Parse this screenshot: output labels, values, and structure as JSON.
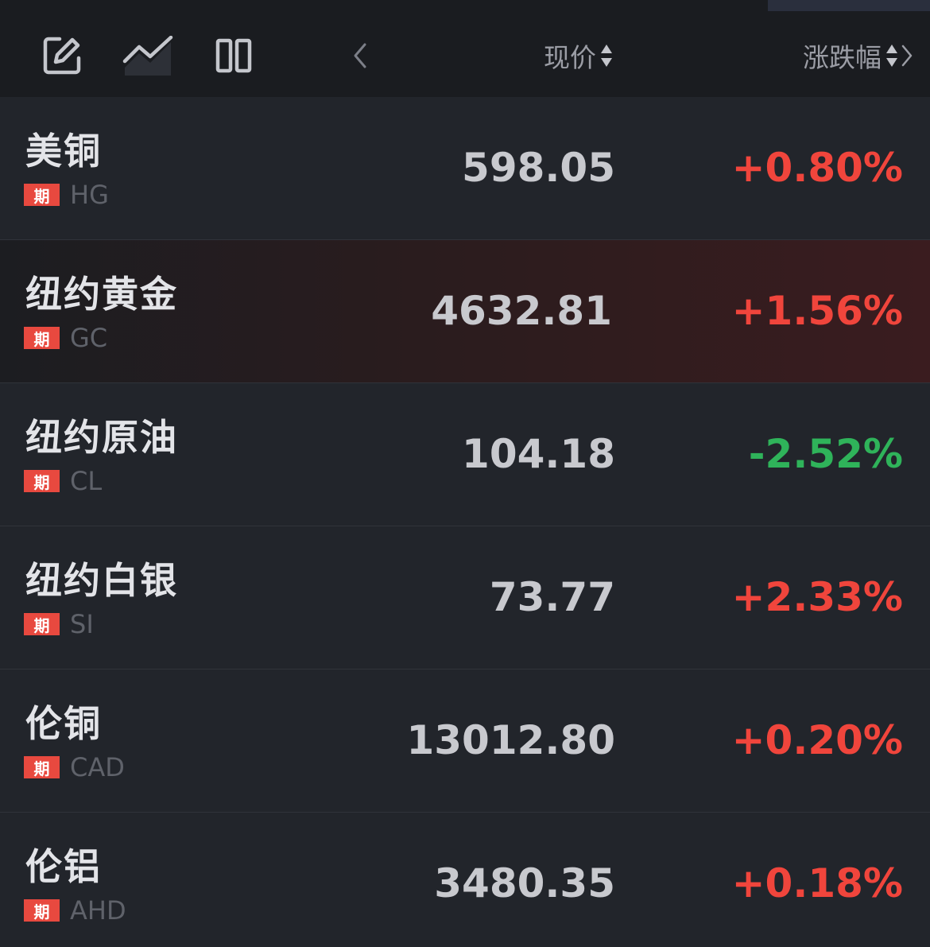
{
  "header": {
    "icons": [
      "edit-icon",
      "trend-chart-icon",
      "columns-icon",
      "chevron-left-icon"
    ],
    "price_label": "现价",
    "change_label": "涨跌幅"
  },
  "colors": {
    "up": "#f0453c",
    "down": "#2fb35a",
    "badge": "#e8493f",
    "background": "#1f2126"
  },
  "rows": [
    {
      "name": "美铜",
      "badge": "期",
      "code": "HG",
      "price": "598.05",
      "change": "+0.80%",
      "direction": "up"
    },
    {
      "name": "纽约黄金",
      "badge": "期",
      "code": "GC",
      "price": "4632.81",
      "change": "+1.56%",
      "direction": "up"
    },
    {
      "name": "纽约原油",
      "badge": "期",
      "code": "CL",
      "price": "104.18",
      "change": "-2.52%",
      "direction": "down"
    },
    {
      "name": "纽约白银",
      "badge": "期",
      "code": "SI",
      "price": "73.77",
      "change": "+2.33%",
      "direction": "up"
    },
    {
      "name": "伦铜",
      "badge": "期",
      "code": "CAD",
      "price": "13012.80",
      "change": "+0.20%",
      "direction": "up"
    },
    {
      "name": "伦铝",
      "badge": "期",
      "code": "AHD",
      "price": "3480.35",
      "change": "+0.18%",
      "direction": "up"
    }
  ]
}
